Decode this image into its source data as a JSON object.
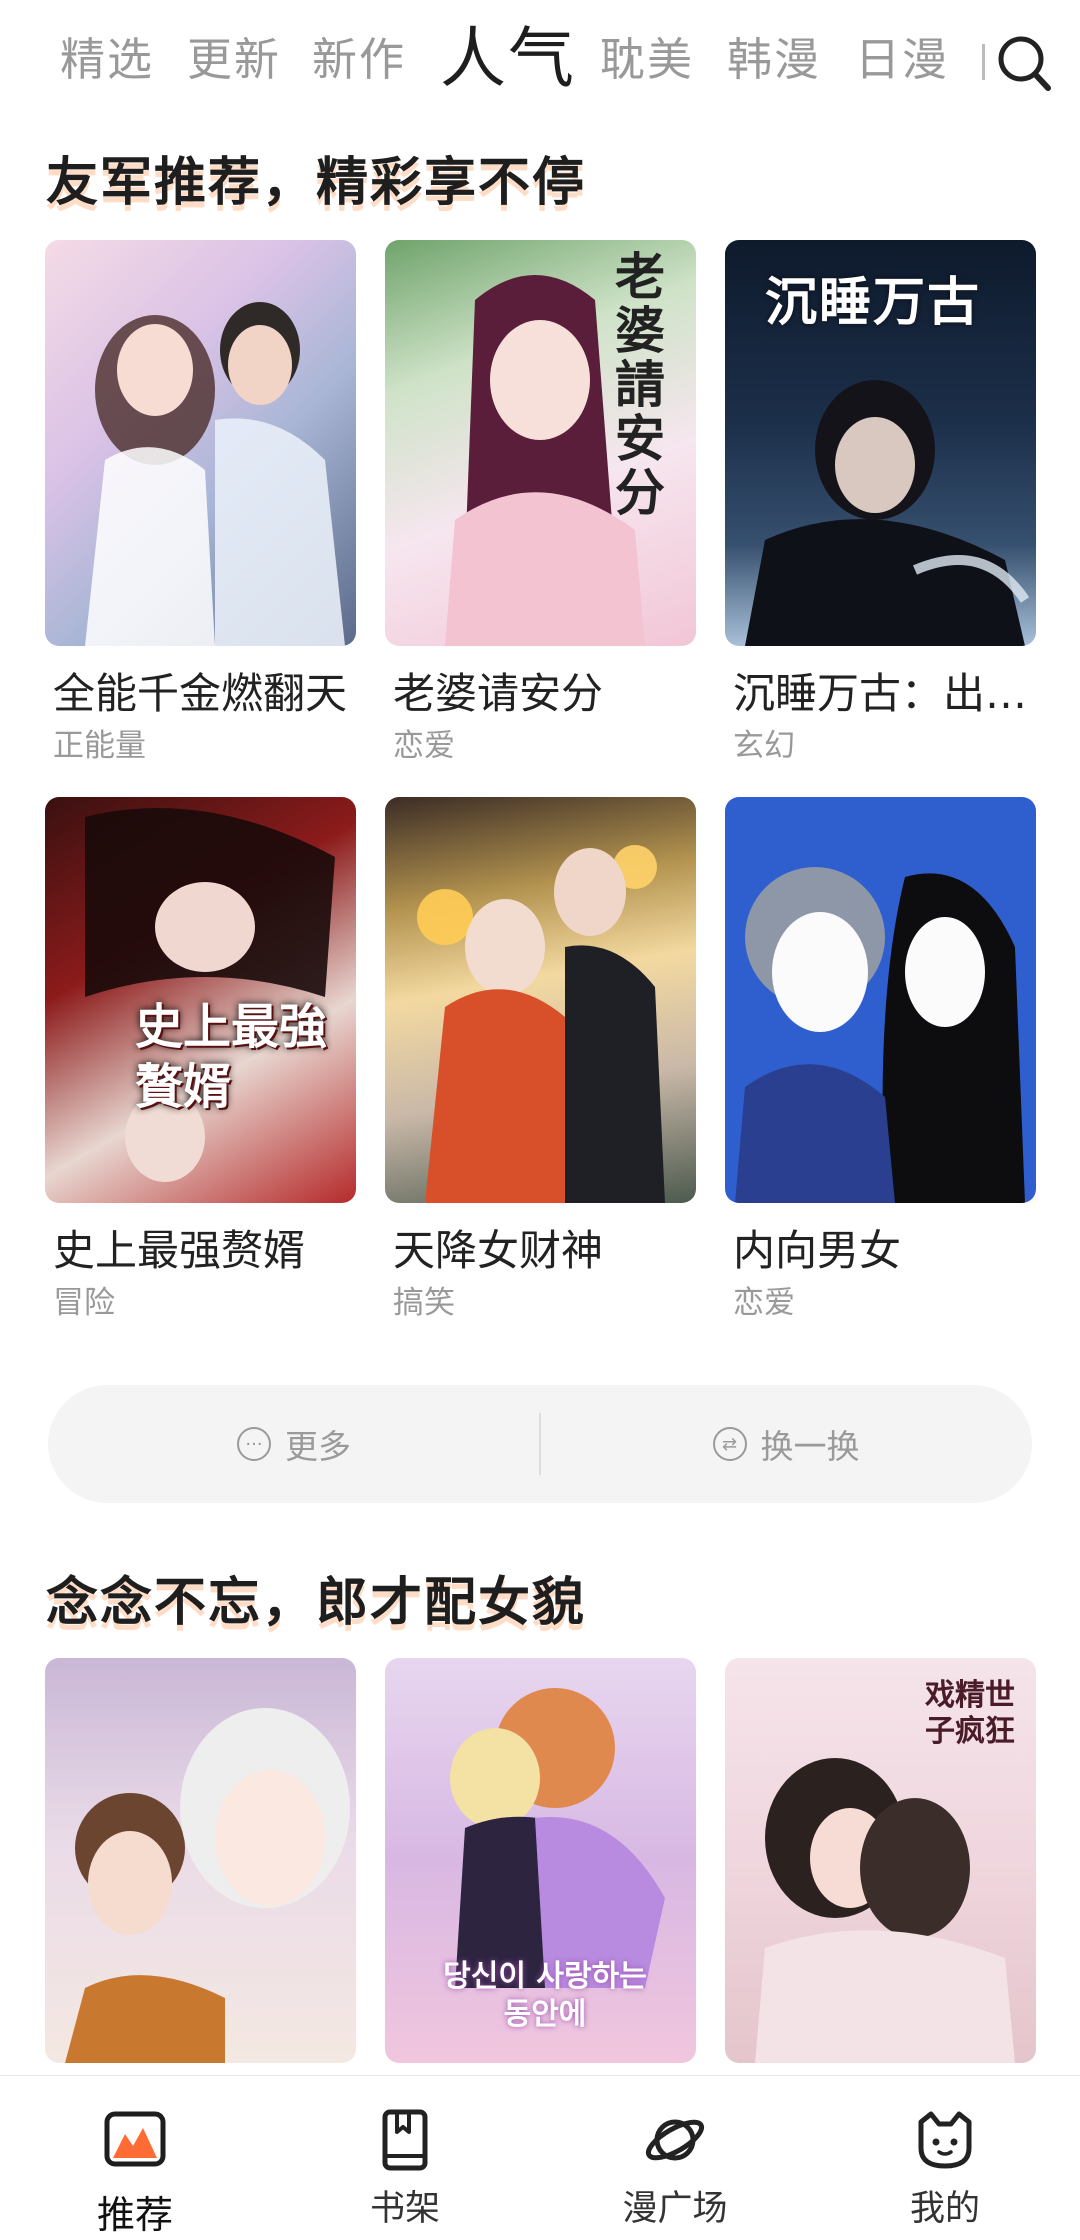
{
  "top_tabs": [
    "精选",
    "更新",
    "新作",
    "人气",
    "耽美",
    "韩漫",
    "日漫"
  ],
  "active_tab": "人气",
  "section1": {
    "title": "友军推荐，精彩享不停",
    "items": [
      {
        "title": "全能千金燃翻天",
        "tag": "正能量"
      },
      {
        "title": "老婆请安分",
        "tag": "恋爱",
        "art_text": "老婆請安分"
      },
      {
        "title": "沉睡万古：出…",
        "tag": "玄幻",
        "art_text": "沉睡万古"
      },
      {
        "title": "史上最强赘婿",
        "tag": "冒险",
        "art_text": "史上最強贅婿"
      },
      {
        "title": "天降女财神",
        "tag": "搞笑"
      },
      {
        "title": "内向男女",
        "tag": "恋爱"
      }
    ]
  },
  "more_bar": {
    "more_label": "更多",
    "swap_label": "换一换"
  },
  "section2": {
    "title": "念念不忘，郎才配女貌",
    "items": [
      {
        "art_text": ""
      },
      {
        "art_text": "당신이 사랑하는 동안에"
      },
      {
        "art_text": "戏精世子疯狂"
      }
    ]
  },
  "bottom_nav": [
    {
      "label": "推荐",
      "icon": "recommend-icon"
    },
    {
      "label": "书架",
      "icon": "bookshelf-icon"
    },
    {
      "label": "漫广场",
      "icon": "planet-icon"
    },
    {
      "label": "我的",
      "icon": "profile-cat-icon"
    }
  ],
  "colors": {
    "accent": "#ff6b35",
    "title_glow": "#ff9a5a",
    "muted": "#999999"
  }
}
